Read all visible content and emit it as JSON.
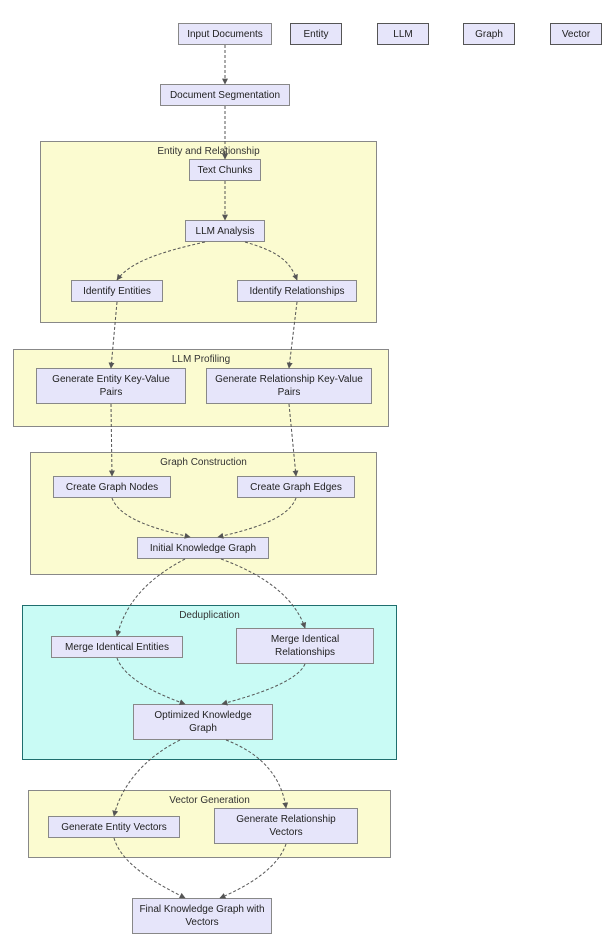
{
  "legend": {
    "entity": "Entity",
    "llm": "LLM",
    "graph": "Graph",
    "vector": "Vector"
  },
  "nodes": {
    "input_documents": "Input Documents",
    "document_segmentation": "Document Segmentation",
    "text_chunks": "Text Chunks",
    "llm_analysis": "LLM Analysis",
    "identify_entities": "Identify Entities",
    "identify_relationships": "Identify Relationships",
    "gen_entity_kv": "Generate Entity Key-Value Pairs",
    "gen_rel_kv": "Generate Relationship Key-Value Pairs",
    "create_nodes": "Create Graph Nodes",
    "create_edges": "Create Graph Edges",
    "initial_kg": "Initial Knowledge Graph",
    "merge_entities": "Merge Identical Entities",
    "merge_relationships": "Merge Identical Relationships",
    "optimized_kg": "Optimized Knowledge Graph",
    "gen_entity_vectors": "Generate Entity Vectors",
    "gen_rel_vectors": "Generate Relationship Vectors",
    "final_kg": "Final Knowledge Graph with Vectors"
  },
  "subgraphs": {
    "entity_rel": "Entity and Relationship",
    "llm_profiling": "LLM Profiling",
    "graph_construction": "Graph Construction",
    "deduplication": "Deduplication",
    "vector_generation": "Vector Generation"
  },
  "chart_data": {
    "type": "flowchart",
    "layout": "top-down",
    "nodes": [
      {
        "id": "A",
        "label": "Input Documents"
      },
      {
        "id": "B",
        "label": "Document Segmentation"
      },
      {
        "id": "C",
        "label": "Text Chunks"
      },
      {
        "id": "D",
        "label": "LLM Analysis"
      },
      {
        "id": "E1",
        "label": "Identify Entities"
      },
      {
        "id": "E2",
        "label": "Identify Relationships"
      },
      {
        "id": "F1",
        "label": "Generate Entity Key-Value Pairs"
      },
      {
        "id": "F2",
        "label": "Generate Relationship Key-Value Pairs"
      },
      {
        "id": "G1",
        "label": "Create Graph Nodes"
      },
      {
        "id": "G2",
        "label": "Create Graph Edges"
      },
      {
        "id": "H",
        "label": "Initial Knowledge Graph"
      },
      {
        "id": "I1",
        "label": "Merge Identical Entities"
      },
      {
        "id": "I2",
        "label": "Merge Identical Relationships"
      },
      {
        "id": "J",
        "label": "Optimized Knowledge Graph"
      },
      {
        "id": "K1",
        "label": "Generate Entity Vectors"
      },
      {
        "id": "K2",
        "label": "Generate Relationship Vectors"
      },
      {
        "id": "L",
        "label": "Final Knowledge Graph with Vectors"
      }
    ],
    "edges": [
      {
        "from": "A",
        "to": "B"
      },
      {
        "from": "B",
        "to": "C"
      },
      {
        "from": "C",
        "to": "D"
      },
      {
        "from": "D",
        "to": "E1"
      },
      {
        "from": "D",
        "to": "E2"
      },
      {
        "from": "E1",
        "to": "F1"
      },
      {
        "from": "E2",
        "to": "F2"
      },
      {
        "from": "F1",
        "to": "G1"
      },
      {
        "from": "F2",
        "to": "G2"
      },
      {
        "from": "G1",
        "to": "H"
      },
      {
        "from": "G2",
        "to": "H"
      },
      {
        "from": "H",
        "to": "I1"
      },
      {
        "from": "H",
        "to": "I2"
      },
      {
        "from": "I1",
        "to": "J"
      },
      {
        "from": "I2",
        "to": "J"
      },
      {
        "from": "J",
        "to": "K1"
      },
      {
        "from": "J",
        "to": "K2"
      },
      {
        "from": "K1",
        "to": "L"
      },
      {
        "from": "K2",
        "to": "L"
      }
    ],
    "subgraphs": [
      {
        "id": "ER",
        "label": "Entity and Relationship",
        "style": "yellow",
        "contains": [
          "C",
          "D",
          "E1",
          "E2"
        ]
      },
      {
        "id": "LP",
        "label": "LLM Profiling",
        "style": "yellow",
        "contains": [
          "F1",
          "F2"
        ]
      },
      {
        "id": "GC",
        "label": "Graph Construction",
        "style": "yellow",
        "contains": [
          "G1",
          "G2",
          "H"
        ]
      },
      {
        "id": "DD",
        "label": "Deduplication",
        "style": "teal",
        "contains": [
          "I1",
          "I2",
          "J"
        ]
      },
      {
        "id": "VG",
        "label": "Vector Generation",
        "style": "yellow",
        "contains": [
          "K1",
          "K2"
        ]
      }
    ],
    "legend": [
      "Entity",
      "LLM",
      "Graph",
      "Vector"
    ]
  }
}
